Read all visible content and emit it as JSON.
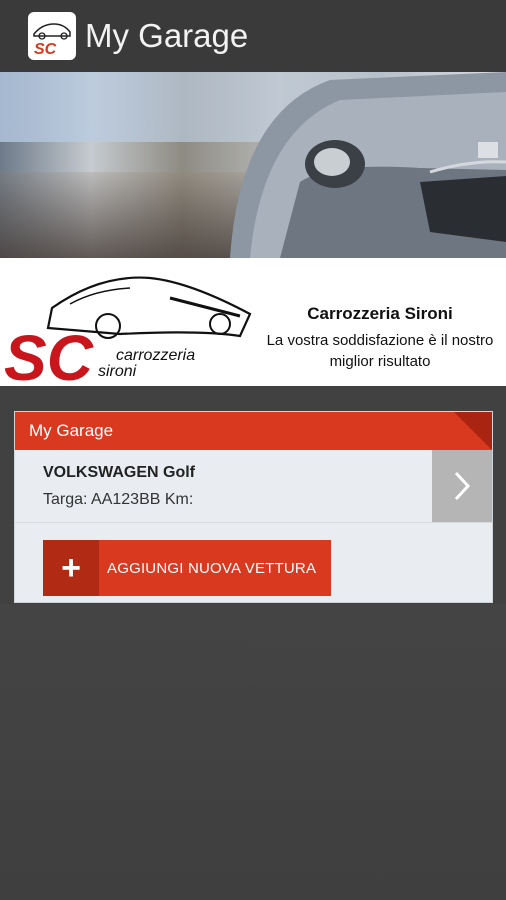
{
  "actionbar": {
    "title": "My Garage",
    "app_icon": "sc-logo-icon"
  },
  "brand": {
    "logo_text_top": "carrozzeria",
    "logo_text_bottom": "sironi",
    "logo_mark": "SC",
    "name": "Carrozzeria Sironi",
    "tagline": "La vostra soddisfazione è il nostro miglior risultato"
  },
  "garage": {
    "header": "My Garage",
    "vehicles": [
      {
        "name": "VOLKSWAGEN Golf",
        "info": "Targa: AA123BB Km:"
      }
    ],
    "add_button": "AGGIUNGI NUOVA VETTURA",
    "add_icon": "plus-icon",
    "arrow_icon": "chevron-right-icon"
  },
  "colors": {
    "accent": "#d8391f",
    "accent_dark": "#b02a14",
    "background": "#414141"
  }
}
